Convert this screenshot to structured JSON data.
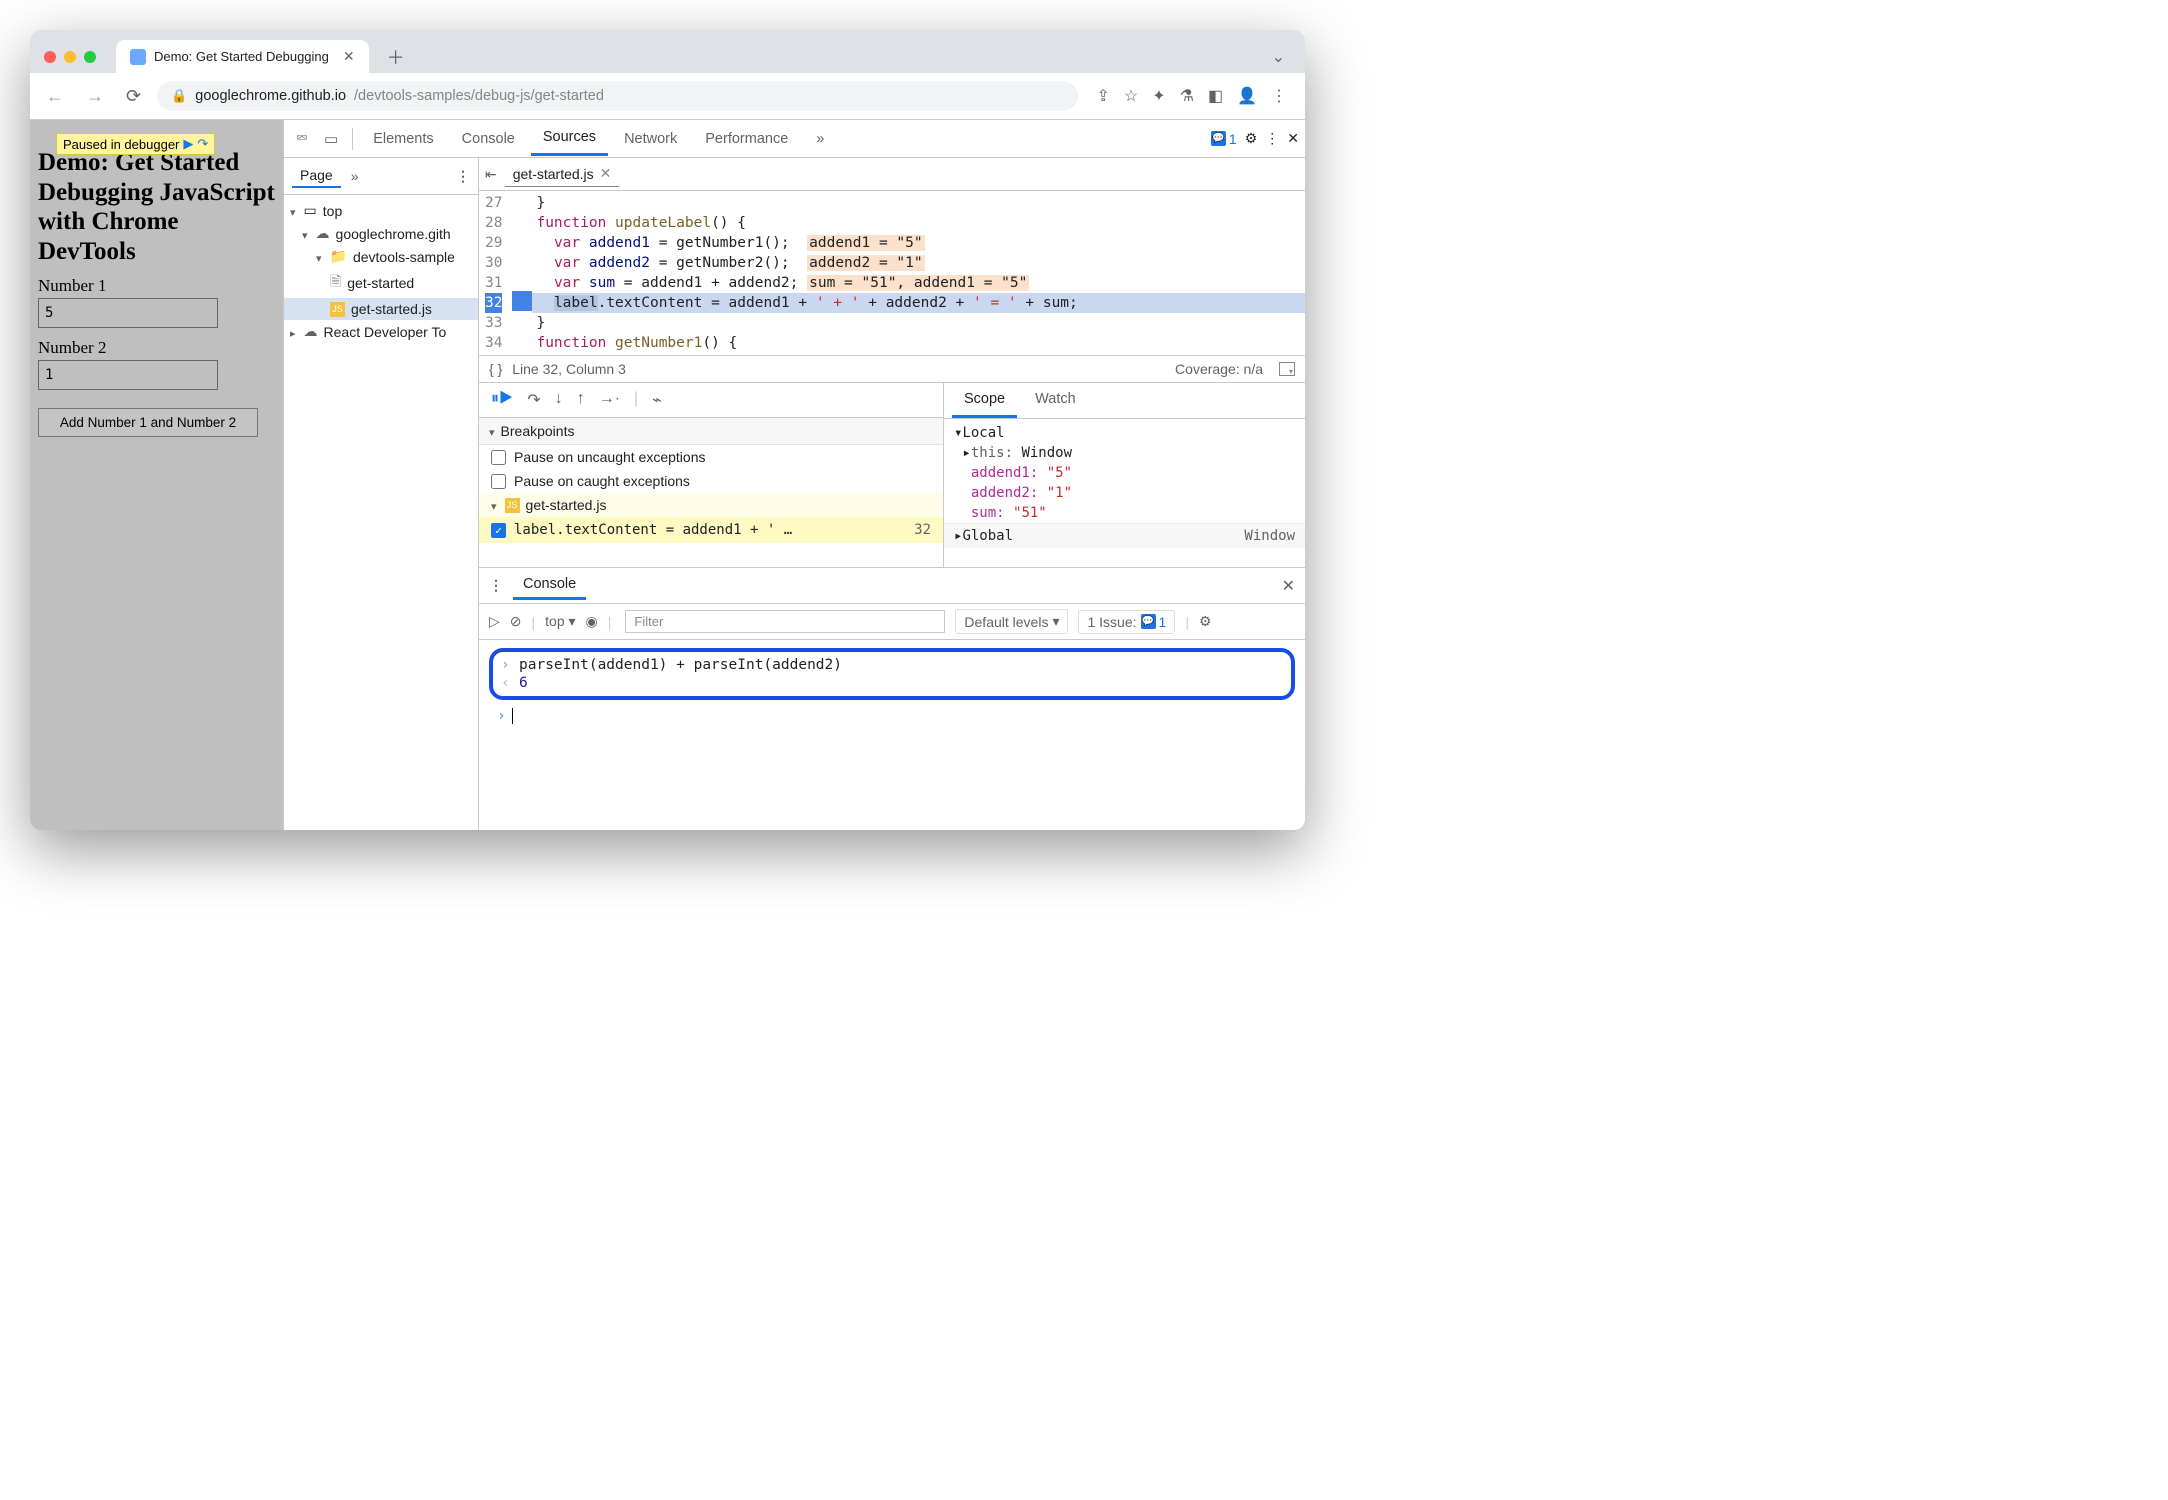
{
  "chrome": {
    "tab_title": "Demo: Get Started Debugging",
    "url_host": "googlechrome.github.io",
    "url_path": "/devtools-samples/debug-js/get-started"
  },
  "page": {
    "paused_label": "Paused in debugger",
    "heading_l1": "Demo: Get Started",
    "heading_rest": "Debugging JavaScript with Chrome DevTools",
    "num1_label": "Number 1",
    "num1_value": "5",
    "num2_label": "Number 2",
    "num2_value": "1",
    "button_label": "Add Number 1 and Number 2"
  },
  "devtools": {
    "tabs": [
      "Elements",
      "Console",
      "Sources",
      "Network",
      "Performance"
    ],
    "issue_count": "1",
    "nav": {
      "page": "Page",
      "top": "top",
      "domain": "googlechrome.gith",
      "folder": "devtools-sample",
      "file_html": "get-started",
      "file_js": "get-started.js",
      "ext": "React Developer To"
    },
    "file_tab": "get-started.js",
    "code": {
      "lines": [
        {
          "n": "27",
          "text": "}"
        },
        {
          "n": "28",
          "kw": "function ",
          "fn": "updateLabel",
          "rest": "() {"
        },
        {
          "n": "29",
          "pre": "  ",
          "kw": "var ",
          "id": "addend1",
          "rest": " = getNumber1();",
          "tag": "addend1 = \"5\""
        },
        {
          "n": "30",
          "pre": "  ",
          "kw": "var ",
          "id": "addend2",
          "rest": " = getNumber2();",
          "tag": "addend2 = \"1\""
        },
        {
          "n": "31",
          "pre": "  ",
          "kw": "var ",
          "id": "sum",
          "rest": " = addend1 + addend2;",
          "tag": "sum = \"51\", addend1 = \"5\""
        },
        {
          "n": "32",
          "hl": true,
          "sel": "label",
          "rest": ".textContent = addend1 + ",
          "s1": "' + '",
          "r2": " + addend2 + ",
          "s2": "' = '",
          "r3": " + sum;"
        },
        {
          "n": "33",
          "text": "}"
        },
        {
          "n": "34",
          "kw": "function ",
          "fn": "getNumber1",
          "rest": "() {"
        }
      ]
    },
    "status": {
      "pos": "Line 32, Column 3",
      "coverage_label": "Coverage: n/a"
    },
    "breakpoints": {
      "header": "Breakpoints",
      "uncaught": "Pause on uncaught exceptions",
      "caught": "Pause on caught exceptions",
      "file": "get-started.js",
      "entry": "label.textContent = addend1 + ' …",
      "entry_line": "32"
    },
    "scope": {
      "tab1": "Scope",
      "tab2": "Watch",
      "local": "Local",
      "this_label": "this: ",
      "this_val": "Window",
      "v1": "addend1: ",
      "v1v": "\"5\"",
      "v2": "addend2: ",
      "v2v": "\"1\"",
      "v3": "sum: ",
      "v3v": "\"51\"",
      "global": "Global",
      "global_val": "Window"
    },
    "console": {
      "tab": "Console",
      "context": "top",
      "filter_placeholder": "Filter",
      "levels": "Default levels",
      "issue_label": "1 Issue:",
      "issue_n": "1",
      "expr": "parseInt(addend1) + parseInt(addend2)",
      "result": "6"
    }
  }
}
